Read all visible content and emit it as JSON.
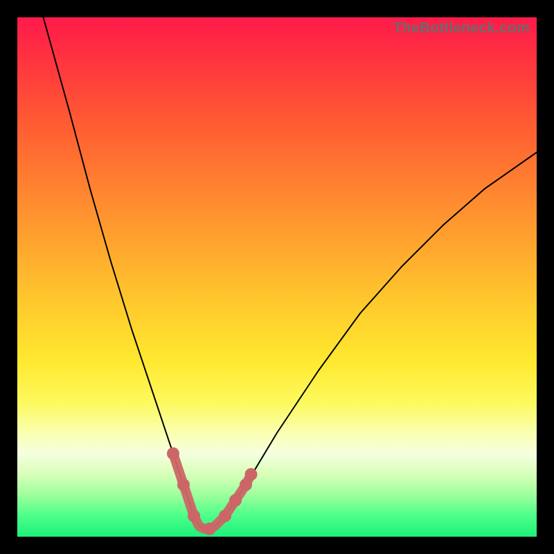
{
  "watermark": "TheBottleneck.com",
  "chart_data": {
    "type": "line",
    "title": "",
    "xlabel": "",
    "ylabel": "",
    "xlim": [
      0,
      100
    ],
    "ylim": [
      0,
      100
    ],
    "grid": false,
    "legend": false,
    "series": [
      {
        "name": "bottleneck-curve",
        "x": [
          5,
          10,
          14,
          18,
          22,
          26,
          30,
          32,
          33,
          34,
          35,
          36,
          37,
          38,
          40,
          44,
          50,
          58,
          66,
          74,
          82,
          90,
          100
        ],
        "values": [
          100,
          82,
          67,
          53,
          40,
          28,
          16,
          10,
          7,
          4,
          2,
          1.5,
          1.5,
          2,
          4,
          10,
          20,
          32,
          43,
          52,
          60,
          67,
          74
        ]
      }
    ],
    "highlight_points": {
      "name": "selected-range",
      "color": "#cc6666",
      "x": [
        30,
        31,
        32,
        33,
        34,
        35,
        36,
        37,
        38,
        39,
        40,
        41,
        42,
        43,
        44,
        45
      ],
      "values": [
        16,
        13,
        10,
        7,
        4,
        2,
        1.5,
        1.5,
        2,
        3,
        4,
        5.5,
        7,
        8.5,
        10,
        12
      ]
    },
    "background_gradient": {
      "top": "#ff1a4a",
      "middle": "#ffe82f",
      "bottom": "#1cf07a"
    }
  }
}
